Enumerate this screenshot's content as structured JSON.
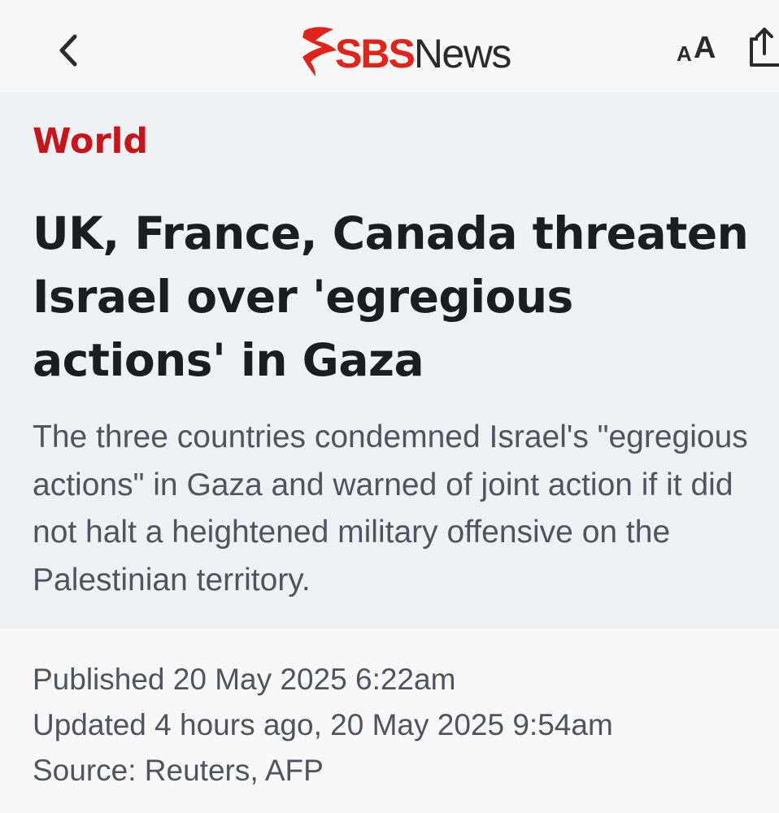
{
  "header": {
    "back_icon": "chevron-left-icon",
    "logo": {
      "brand": "SBS",
      "product": "News",
      "brand_color": "#e2231a"
    },
    "text_size": {
      "small": "A",
      "large": "A"
    },
    "share_icon": "share-icon"
  },
  "article": {
    "category": "World",
    "category_color": "#c8151b",
    "headline": "UK, France, Canada threaten Israel over 'egregious actions' in Gaza",
    "standfirst": "The three countries condemned Israel's \"egregious actions\" in Gaza and warned of joint action if it did not halt a heightened military offensive on the Palestinian territory.",
    "published": "Published 20 May 2025 6:22am",
    "updated": "Updated 4 hours ago, 20 May 2025 9:54am",
    "source": "Source: Reuters, AFP"
  }
}
